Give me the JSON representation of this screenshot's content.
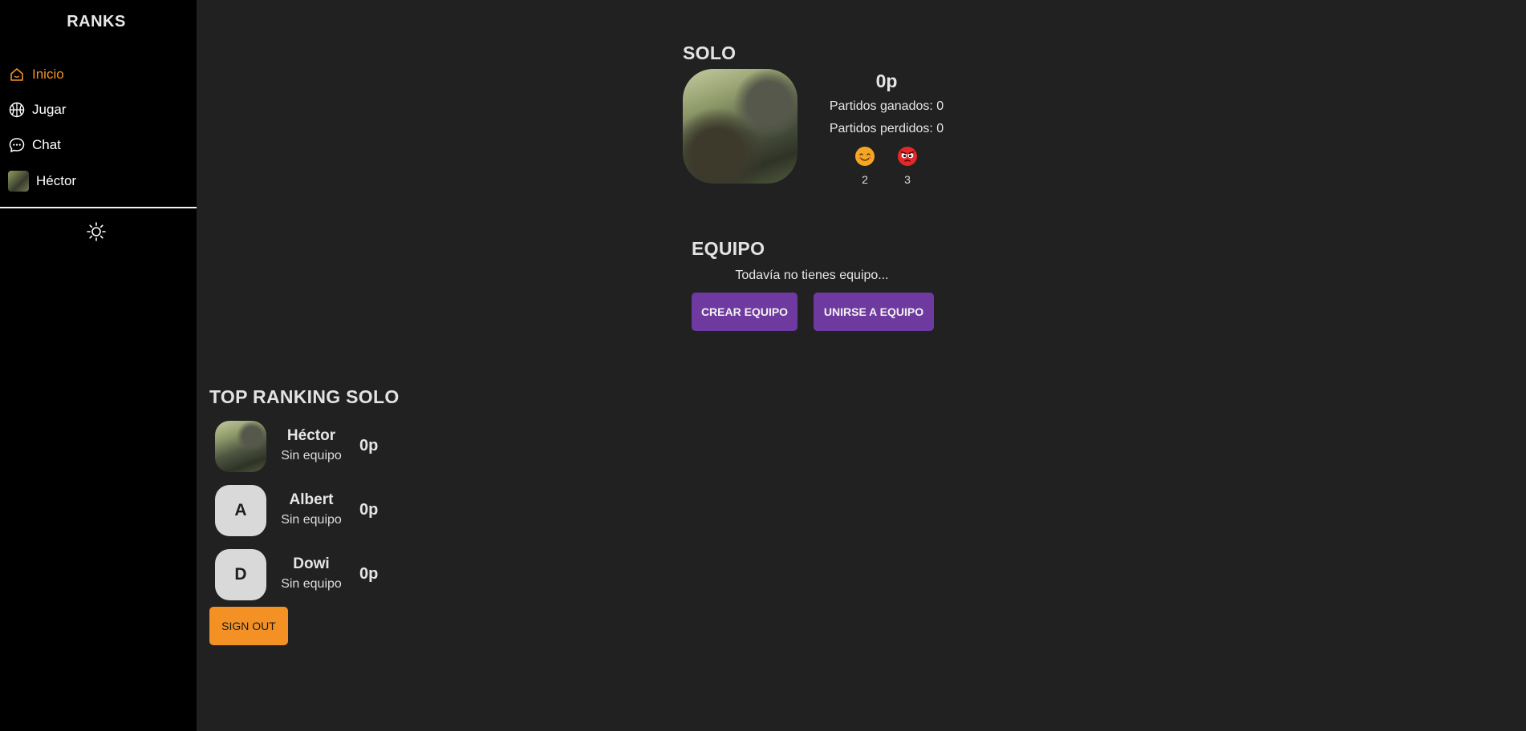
{
  "sidebar": {
    "brand": "RANKS",
    "items": [
      {
        "label": "Inicio",
        "icon": "home-icon",
        "active": true
      },
      {
        "label": "Jugar",
        "icon": "basketball-icon",
        "active": false
      },
      {
        "label": "Chat",
        "icon": "chat-bubble-icon",
        "active": false
      },
      {
        "label": "Héctor",
        "icon": "user-avatar",
        "active": false
      }
    ],
    "theme_toggle_icon": "sun-icon"
  },
  "solo": {
    "title": "SOLO",
    "points": "0p",
    "won": "Partidos ganados: 0",
    "lost": "Partidos perdidos: 0",
    "reactions": [
      {
        "icon": "smiling-face-icon",
        "count": "2",
        "color": "#f5a623"
      },
      {
        "icon": "angry-face-icon",
        "count": "3",
        "color": "#e02a2a"
      }
    ]
  },
  "team": {
    "title": "EQUIPO",
    "empty_text": "Todavía no tienes equipo...",
    "create_label": "CREAR EQUIPO",
    "join_label": "UNIRSE A EQUIPO"
  },
  "ranking": {
    "title": "TOP RANKING SOLO",
    "rows": [
      {
        "name": "Héctor",
        "team": "Sin equipo",
        "points": "0p",
        "initial": ""
      },
      {
        "name": "Albert",
        "team": "Sin equipo",
        "points": "0p",
        "initial": "A"
      },
      {
        "name": "Dowi",
        "team": "Sin equipo",
        "points": "0p",
        "initial": "D"
      }
    ]
  },
  "signout_label": "SIGN OUT",
  "colors": {
    "accent_orange": "#f39124",
    "button_purple": "#6f3aa0",
    "background": "#212121",
    "sidebar": "#000000"
  }
}
